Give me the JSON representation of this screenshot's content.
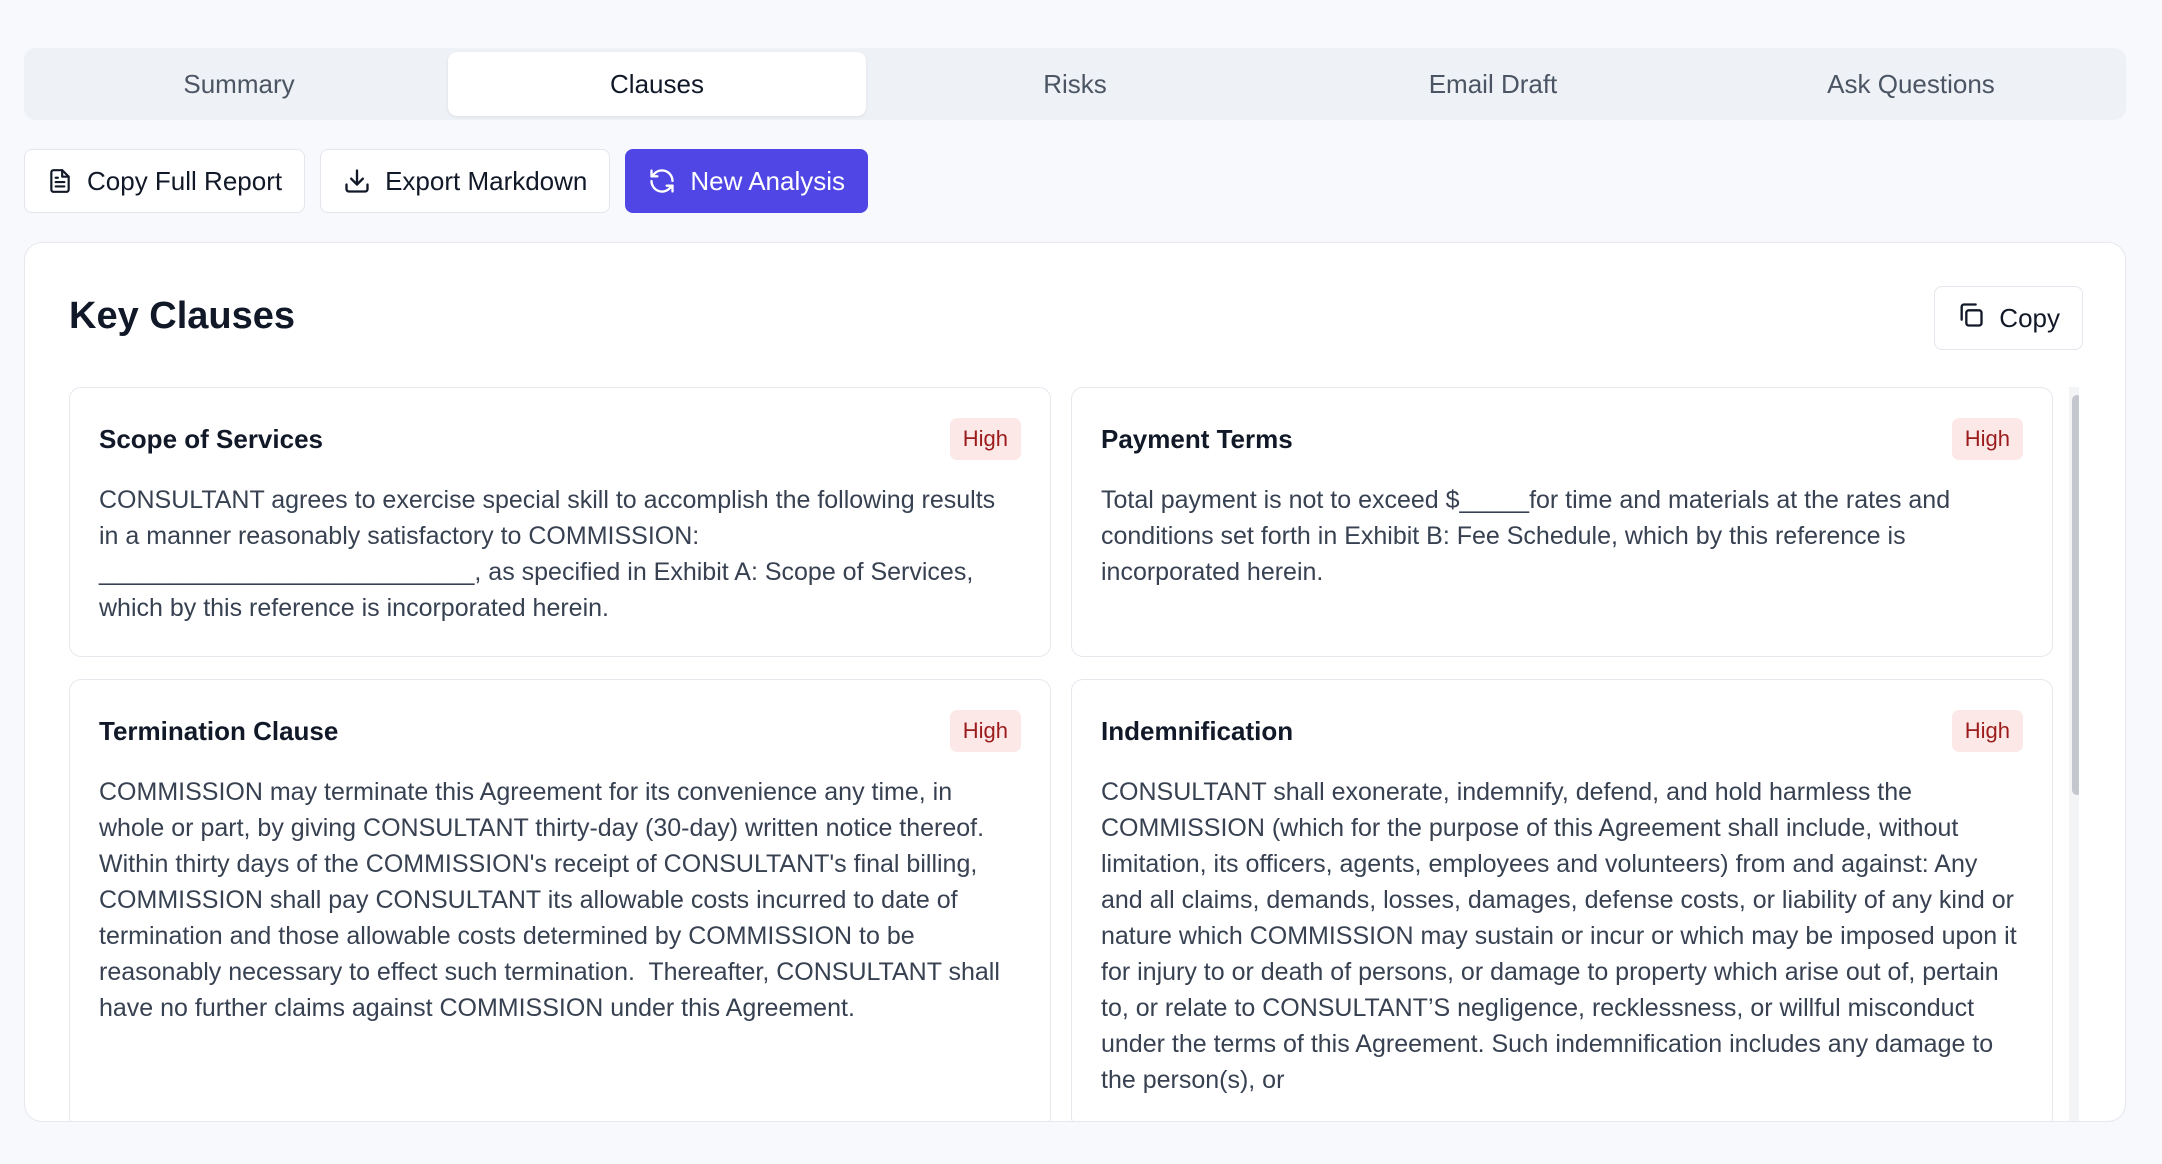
{
  "tabs": [
    {
      "label": "Summary"
    },
    {
      "label": "Clauses"
    },
    {
      "label": "Risks"
    },
    {
      "label": "Email Draft"
    },
    {
      "label": "Ask Questions"
    }
  ],
  "active_tab": "Clauses",
  "toolbar": {
    "copy_report_label": "Copy Full Report",
    "export_label": "Export Markdown",
    "new_analysis_label": "New Analysis"
  },
  "section": {
    "title": "Key Clauses",
    "copy_label": "Copy"
  },
  "clauses": [
    {
      "title": "Scope of Services",
      "badge": "High",
      "text": "CONSULTANT agrees to exercise special skill to accomplish the following results in a manner reasonably satisfactory to COMMISSION: ___________________________, as specified in Exhibit A: Scope of Services, which by this reference is incorporated herein."
    },
    {
      "title": "Payment Terms",
      "badge": "High",
      "text": "Total payment is not to exceed $_____for time and materials at the rates and conditions set forth in Exhibit B: Fee Schedule, which by this reference is incorporated herein."
    },
    {
      "title": "Termination Clause",
      "badge": "High",
      "text": "COMMISSION may terminate this Agreement for its convenience any time, in whole or part, by giving CONSULTANT thirty-day (30-day) written notice thereof.  Within thirty days of the COMMISSION's receipt of CONSULTANT's final billing, COMMISSION shall pay CONSULTANT its allowable costs incurred to date of termination and those allowable costs determined by COMMISSION to be reasonably necessary to effect such termination.  Thereafter, CONSULTANT shall have no further claims against COMMISSION under this Agreement."
    },
    {
      "title": "Indemnification",
      "badge": "High",
      "text": "CONSULTANT shall exonerate, indemnify, defend, and hold harmless the COMMISSION (which for the purpose of this Agreement shall include, without limitation, its officers, agents, employees and volunteers) from and against: Any and all claims, demands, losses, damages, defense costs, or liability of any kind or nature which COMMISSION may sustain or incur or which may be imposed upon it for injury to or death of persons, or damage to property which arise out of, pertain to, or relate to CONSULTANT’S negligence, recklessness, or willful misconduct under the terms of this Agreement. Such indemnification includes any damage to the person(s), or"
    }
  ],
  "colors": {
    "primary": "#4f46e5",
    "badge_bg": "#fde8e8",
    "badge_text": "#9b1c1c"
  }
}
